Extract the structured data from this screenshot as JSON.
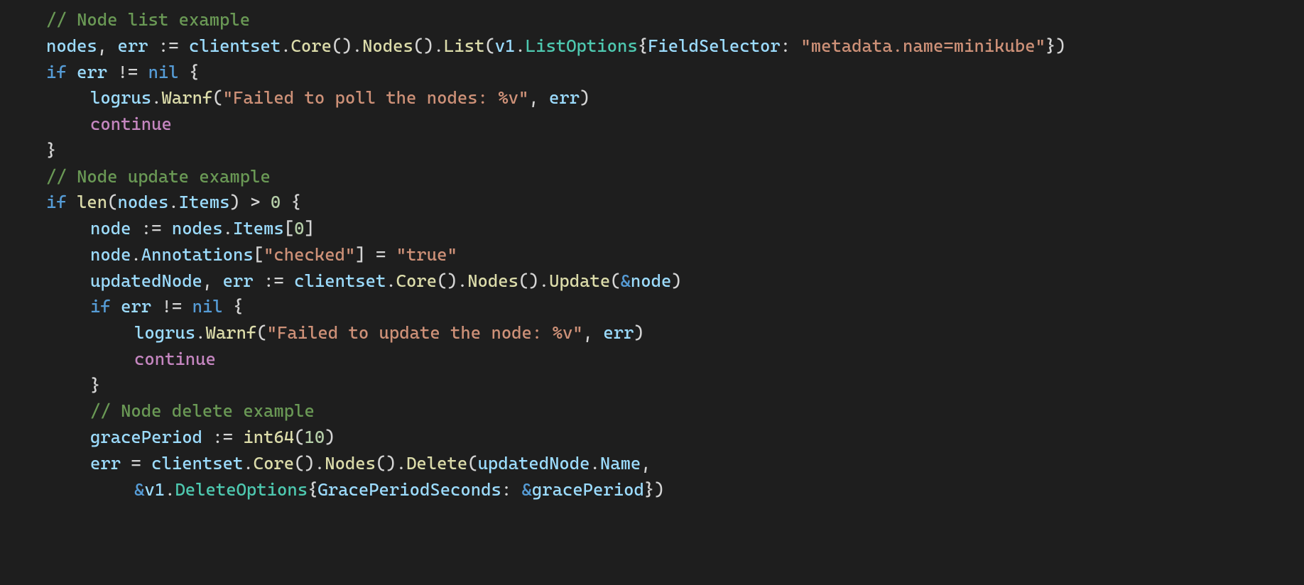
{
  "code": {
    "c1": "// Node list example",
    "l2": {
      "nodes": "nodes",
      "c1": ", ",
      "err": "err",
      "assign": " := ",
      "clientset": "clientset",
      "d1": ".",
      "Core": "Core",
      "p1": "().",
      "Nodes": "Nodes",
      "p2": "().",
      "List": "List",
      "p3": "(",
      "v1": "v1",
      "d2": ".",
      "ListOptions": "ListOptions",
      "ob": "{",
      "FieldSelector": "FieldSelector",
      "col": ": ",
      "str": "\"metadata.name=minikube\"",
      "cb": "})"
    },
    "l3": {
      "if": "if",
      "sp": " ",
      "err": "err",
      "neq": " != ",
      "nil": "nil",
      "ob": " {"
    },
    "l4": {
      "logrus": "logrus",
      "d": ".",
      "Warnf": "Warnf",
      "op": "(",
      "str": "\"Failed to poll the nodes: %v\"",
      "c": ", ",
      "err": "err",
      "cp": ")"
    },
    "l5": {
      "continue": "continue"
    },
    "l6": {
      "cb": "}"
    },
    "c2": "// Node update example",
    "l8": {
      "if": "if",
      "sp": " ",
      "len": "len",
      "op": "(",
      "nodes": "nodes",
      "d": ".",
      "Items": "Items",
      "cp": ")",
      "gt": " > ",
      "zero": "0",
      "ob": " {"
    },
    "l9": {
      "node": "node",
      "assign": " := ",
      "nodes": "nodes",
      "d": ".",
      "Items": "Items",
      "br": "[",
      "zero": "0",
      "br2": "]"
    },
    "l10": {
      "node": "node",
      "d": ".",
      "Annotations": "Annotations",
      "br": "[",
      "key": "\"checked\"",
      "br2": "] = ",
      "val": "\"true\""
    },
    "l11": {
      "updatedNode": "updatedNode",
      "c1": ", ",
      "err": "err",
      "assign": " := ",
      "clientset": "clientset",
      "d1": ".",
      "Core": "Core",
      "p1": "().",
      "Nodes": "Nodes",
      "p2": "().",
      "Update": "Update",
      "op": "(",
      "amp": "&",
      "node": "node",
      "cp": ")"
    },
    "l12": {
      "if": "if",
      "sp": " ",
      "err": "err",
      "neq": " != ",
      "nil": "nil",
      "ob": " {"
    },
    "l13": {
      "logrus": "logrus",
      "d": ".",
      "Warnf": "Warnf",
      "op": "(",
      "str": "\"Failed to update the node: %v\"",
      "c": ", ",
      "err": "err",
      "cp": ")"
    },
    "l14": {
      "continue": "continue"
    },
    "l15": {
      "cb": "}"
    },
    "c3": "// Node delete example",
    "l17": {
      "gracePeriod": "gracePeriod",
      "assign": " := ",
      "int64": "int64",
      "op": "(",
      "ten": "10",
      "cp": ")"
    },
    "l18": {
      "err": "err",
      "eq": " = ",
      "clientset": "clientset",
      "d1": ".",
      "Core": "Core",
      "p1": "().",
      "Nodes": "Nodes",
      "p2": "().",
      "Delete": "Delete",
      "op": "(",
      "updatedNode": "updatedNode",
      "d2": ".",
      "Name": "Name",
      "comma": ","
    },
    "l19": {
      "amp": "&",
      "v1": "v1",
      "d": ".",
      "DeleteOptions": "DeleteOptions",
      "ob": "{",
      "GracePeriodSeconds": "GracePeriodSeconds",
      "col": ": ",
      "amp2": "&",
      "gracePeriod": "gracePeriod",
      "cb": "})"
    }
  }
}
